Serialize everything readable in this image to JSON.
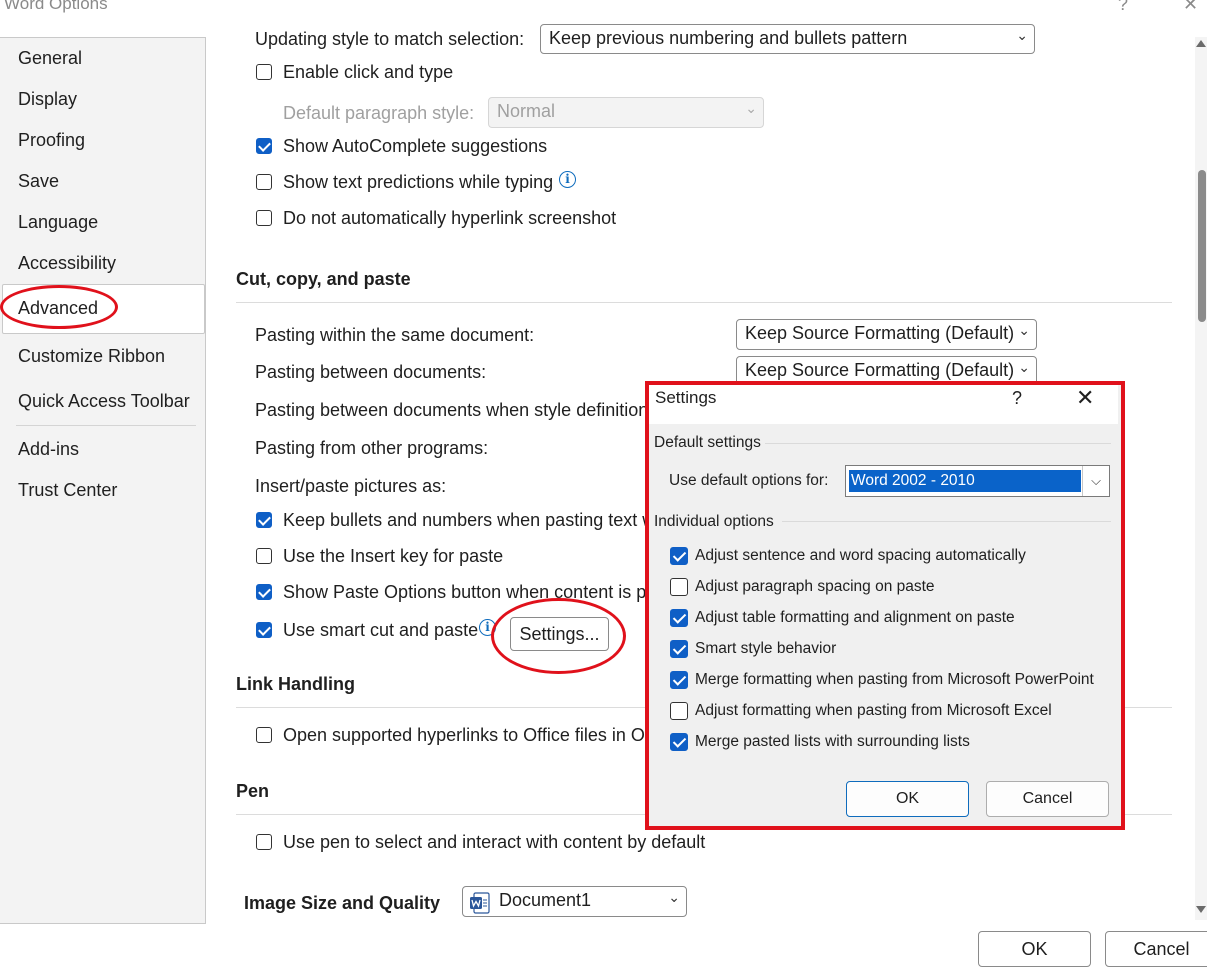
{
  "window": {
    "title": "Word Options",
    "help_glyph": "?",
    "close_glyph": "✕"
  },
  "sidebar": {
    "items": [
      {
        "label": "General"
      },
      {
        "label": "Display"
      },
      {
        "label": "Proofing"
      },
      {
        "label": "Save"
      },
      {
        "label": "Language"
      },
      {
        "label": "Accessibility"
      },
      {
        "label": "Advanced",
        "selected": true
      },
      {
        "label": "Customize Ribbon"
      },
      {
        "label": "Quick Access Toolbar"
      },
      {
        "label": "Add-ins"
      },
      {
        "label": "Trust Center"
      }
    ]
  },
  "editing": {
    "updating_style_label": "Updating style to match selection:",
    "updating_style_value": "Keep previous numbering and bullets pattern",
    "enable_click_type": "Enable click and type",
    "default_para_style_label": "Default paragraph style:",
    "default_para_style_value": "Normal",
    "show_autocomplete": "Show AutoComplete suggestions",
    "show_text_predictions": "Show text predictions while typing",
    "no_auto_hyperlink": "Do not automatically hyperlink screenshot"
  },
  "cut_copy_paste": {
    "heading": "Cut, copy, and paste",
    "within_doc_label": "Pasting within the same document:",
    "within_doc_value": "Keep Source Formatting (Default)",
    "between_docs_label": "Pasting between documents:",
    "between_docs_value": "Keep Source Formatting (Default)",
    "style_conflict_label": "Pasting between documents when style definitions",
    "other_programs_label": "Pasting from other programs:",
    "insert_pictures_label": "Insert/paste pictures as:",
    "keep_bullets": "Keep bullets and numbers when pasting text w",
    "use_insert_key": "Use the Insert key for paste",
    "show_paste_options": "Show Paste Options button when content is p",
    "smart_cut_paste": "Use smart cut and paste",
    "settings_button": "Settings..."
  },
  "link_handling": {
    "heading": "Link Handling",
    "open_hyperlinks": "Open supported hyperlinks to Office files in O"
  },
  "pen": {
    "heading": "Pen",
    "use_pen": "Use pen to select and interact with content by default"
  },
  "image_quality": {
    "heading": "Image Size and Quality",
    "document_value": "Document1"
  },
  "footer": {
    "ok": "OK",
    "cancel": "Cancel"
  },
  "settings_dialog": {
    "title": "Settings",
    "help_glyph": "?",
    "close_glyph": "✕",
    "default_settings_heading": "Default settings",
    "use_default_label": "Use default options for:",
    "use_default_value": "Word 2002 - 2010",
    "individual_heading": "Individual options",
    "options": [
      {
        "label": "Adjust sentence and word spacing automatically",
        "checked": true
      },
      {
        "label": "Adjust paragraph spacing on paste",
        "checked": false
      },
      {
        "label": "Adjust table formatting and alignment on paste",
        "checked": true
      },
      {
        "label": "Smart style behavior",
        "checked": true
      },
      {
        "label": "Merge formatting when pasting from Microsoft PowerPoint",
        "checked": true
      },
      {
        "label": "Adjust formatting when pasting from Microsoft Excel",
        "checked": false
      },
      {
        "label": "Merge pasted lists with surrounding lists",
        "checked": true
      }
    ],
    "ok": "OK",
    "cancel": "Cancel"
  },
  "colors": {
    "accent": "#0f5fc6",
    "annotation_red": "#e0111b"
  }
}
